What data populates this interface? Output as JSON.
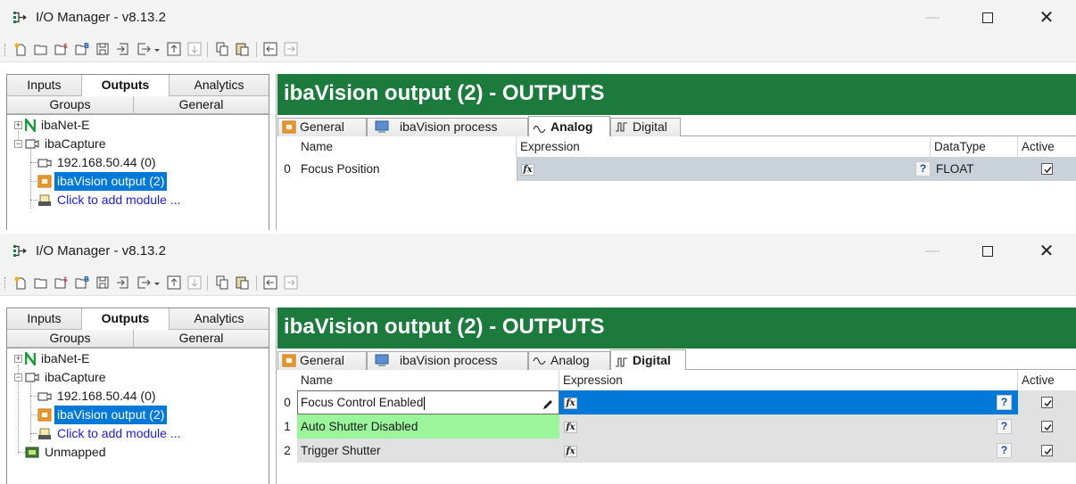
{
  "windows": [
    {
      "title": "I/O Manager - v8.13.2",
      "left_tabs": [
        {
          "label": "Inputs",
          "active": false
        },
        {
          "label": "Outputs",
          "active": true
        },
        {
          "label": "Analytics",
          "active": false
        },
        {
          "label": "Groups",
          "active": false
        },
        {
          "label": "General",
          "active": false
        }
      ],
      "tree": [
        {
          "label": "ibaNet-E",
          "icon": "iba-n-icon"
        },
        {
          "label": "ibaCapture",
          "icon": "capture-icon"
        },
        {
          "label": "192.168.50.44 (0)",
          "icon": "camera-icon"
        },
        {
          "label": "ibaVision output (2)",
          "icon": "module-icon",
          "selected": true
        },
        {
          "label": "Click to add module ...",
          "icon": "add-module-icon",
          "link": true
        }
      ],
      "banner": "ibaVision output (2) - OUTPUTS",
      "tabs": [
        {
          "label": "General",
          "icon": "general-tab-icon",
          "active": false
        },
        {
          "label": "ibaVision process",
          "icon": "process-tab-icon",
          "active": false
        },
        {
          "label": "Analog",
          "icon": "analog-wave-icon",
          "active": true
        },
        {
          "label": "Digital",
          "icon": "digital-wave-icon",
          "active": false
        }
      ],
      "grid": {
        "columns": [
          "Name",
          "Expression",
          "DataType",
          "Active"
        ],
        "rows": [
          {
            "index": "0",
            "name": "Focus Position",
            "expression": "",
            "datatype": "FLOAT",
            "active": true
          }
        ]
      }
    },
    {
      "title": "I/O Manager - v8.13.2",
      "left_tabs": [
        {
          "label": "Inputs",
          "active": false
        },
        {
          "label": "Outputs",
          "active": true
        },
        {
          "label": "Analytics",
          "active": false
        },
        {
          "label": "Groups",
          "active": false
        },
        {
          "label": "General",
          "active": false
        }
      ],
      "tree": [
        {
          "label": "ibaNet-E",
          "icon": "iba-n-icon"
        },
        {
          "label": "ibaCapture",
          "icon": "capture-icon"
        },
        {
          "label": "192.168.50.44 (0)",
          "icon": "camera-icon"
        },
        {
          "label": "ibaVision output (2)",
          "icon": "module-icon",
          "selected": true
        },
        {
          "label": "Click to add module ...",
          "icon": "add-module-icon",
          "link": true
        },
        {
          "label": "Unmapped",
          "icon": "unmapped-icon"
        }
      ],
      "banner": "ibaVision output (2) - OUTPUTS",
      "tabs": [
        {
          "label": "General",
          "icon": "general-tab-icon",
          "active": false
        },
        {
          "label": "ibaVision process",
          "icon": "process-tab-icon",
          "active": false
        },
        {
          "label": "Analog",
          "icon": "analog-wave-icon",
          "active": false
        },
        {
          "label": "Digital",
          "icon": "digital-wave-icon",
          "active": true
        }
      ],
      "grid": {
        "columns": [
          "Name",
          "Expression",
          "Active"
        ],
        "rows": [
          {
            "index": "0",
            "name": "Focus Control Enabled",
            "expression": "",
            "active": true,
            "state": "editing"
          },
          {
            "index": "1",
            "name": "Auto Shutter Disabled",
            "expression": "",
            "active": true,
            "state": "green"
          },
          {
            "index": "2",
            "name": "Trigger Shutter",
            "expression": "",
            "active": true,
            "state": "gray"
          }
        ]
      }
    }
  ],
  "colors": {
    "banner": "#1b7a3c",
    "selection": "#0078d7",
    "row_gray": "#c9d1da",
    "row_green": "#9bf59b",
    "row_plain": "#e1e1e1",
    "link": "#1d1dd6"
  },
  "toolbar_icons": [
    "new-icon",
    "open-icon",
    "open-special-icon",
    "open-bus-icon",
    "save-icon",
    "import-icon",
    "export-icon",
    "export-dropdown-icon",
    "move-up-icon",
    "move-down-icon",
    "copy-icon",
    "paste-icon",
    "collapse-icon",
    "expand-icon"
  ],
  "window_controls": [
    "minimize-icon",
    "maximize-icon",
    "close-icon"
  ]
}
